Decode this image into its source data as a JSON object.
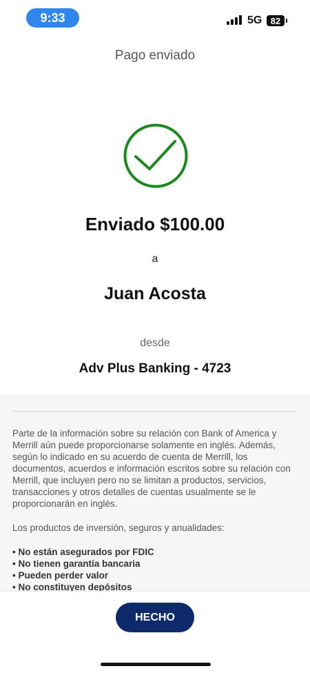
{
  "status_bar": {
    "time": "9:33",
    "network": "5G",
    "battery": "82"
  },
  "header": {
    "title": "Pago enviado"
  },
  "confirmation": {
    "sent_amount": "Enviado $100.00",
    "to_label": "a",
    "recipient": "Juan Acosta",
    "from_label": "desde",
    "account": "Adv Plus Banking - 4723",
    "check_color": "#1a8a1f"
  },
  "disclosure": {
    "paragraph_1": "Parte de la información sobre su relación con Bank of America y Merrill aún puede proporcionarse solamente en inglés. Además, según lo indicado en su acuerdo de cuenta de Merrill, los documentos, acuerdos e información escritos sobre su relación con Merrill, que incluyen pero no se limitan a productos, servicios, transacciones y otros detalles de cuentas usualmente se le proporcionarán en inglés.",
    "paragraph_2": "Los productos de inversión, seguros y anualidades:",
    "bullets": [
      "No están asegurados por FDIC",
      "No tienen garantía bancaria",
      "Pueden perder valor",
      "No constituyen depósitos"
    ]
  },
  "footer": {
    "done_label": "HECHO",
    "button_color": "#0f2a6b"
  }
}
